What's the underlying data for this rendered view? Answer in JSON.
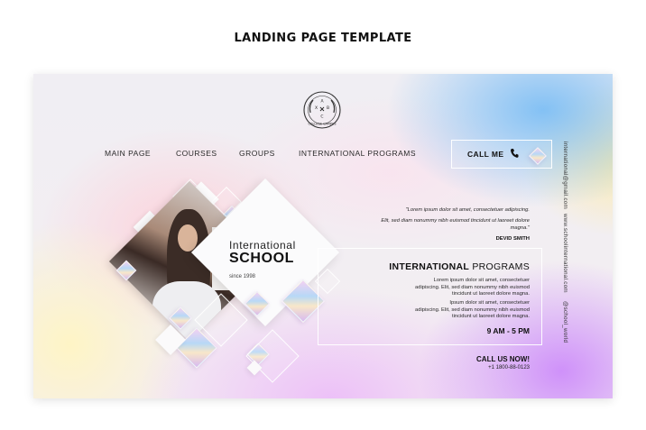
{
  "caption": "LANDING PAGE TEMPLATE",
  "logo": {
    "text": "COLLEGE CAMPUS",
    "letters": [
      "A",
      "X",
      "B",
      "C"
    ]
  },
  "nav": {
    "items": [
      "MAIN PAGE",
      "COURSES",
      "GROUPS",
      "INTERNATIONAL PROGRAMS"
    ],
    "call_label": "CALL ME"
  },
  "side": {
    "email": "international@gmail.com",
    "website": "www.schoolinternational.com",
    "handle": "@school_world"
  },
  "hero": {
    "title_line1": "International",
    "title_line2": "SCHOOL",
    "since": "since 1998"
  },
  "testimonial": {
    "line1": "\"Lorem ipsum dolor sit amet, consectetuer adipiscing.",
    "line2": "Elit, sed diam nonummy nibh euismod tincidunt ut laoreet dolore",
    "line3": "magna.\"",
    "author": "DEVID SMITH"
  },
  "programs": {
    "title_bold": "INTERNATIONAL",
    "title_light": " PROGRAMS",
    "para1": [
      "Lorem ipsum dolor sit amet, consectetuer",
      "adipiscing. Elit, sed diam nonummy nibh euismod",
      "tincidunt ut laoreet dolore magna."
    ],
    "para2": [
      "Ipsum dolor sit amet, consectetuer",
      "adipiscing. Elit, sed diam nonummy nibh euismod",
      "tincidunt ut laoreet dolore magna."
    ],
    "hours": "9 AM - 5 PM"
  },
  "contact": {
    "call_us": "CALL US NOW!",
    "phone": "+1 1800-88-0123"
  }
}
